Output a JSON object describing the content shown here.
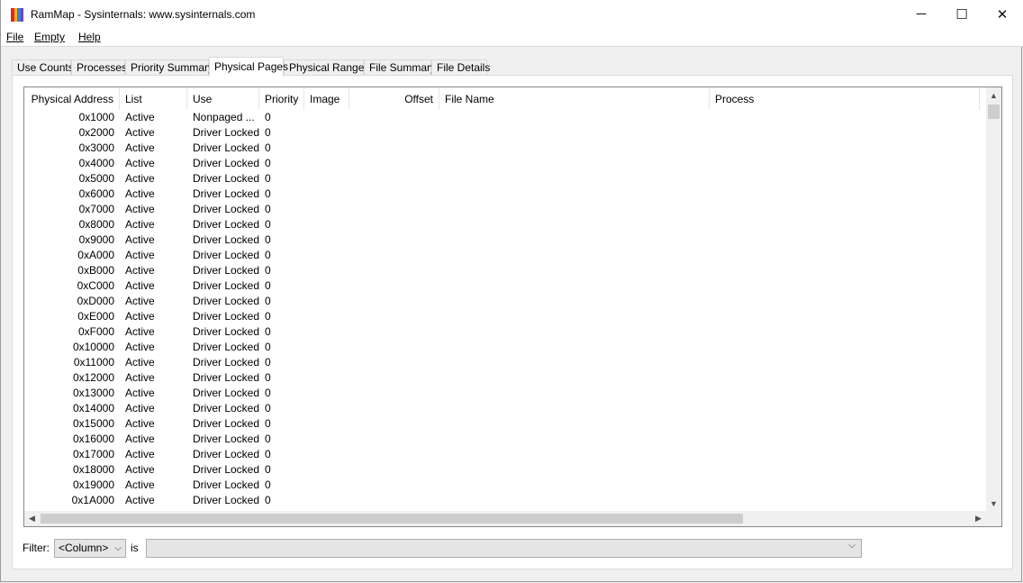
{
  "window": {
    "title": "RamMap - Sysinternals: www.sysinternals.com",
    "controls": {
      "minimize": "─",
      "maximize": "☐",
      "close": "✕"
    },
    "icon_colors": [
      "#e0262c",
      "#f6b20a",
      "#3a7ed8",
      "#7a3fb8"
    ]
  },
  "menu": [
    {
      "label": "File"
    },
    {
      "label": "Empty"
    },
    {
      "label": "Help"
    }
  ],
  "tabs": [
    {
      "label": "Use Counts",
      "active": false
    },
    {
      "label": "Processes",
      "active": false
    },
    {
      "label": "Priority Summary",
      "active": false
    },
    {
      "label": "Physical Pages",
      "active": true
    },
    {
      "label": "Physical Ranges",
      "active": false
    },
    {
      "label": "File Summary",
      "active": false
    },
    {
      "label": "File Details",
      "active": false
    }
  ],
  "table": {
    "columns": [
      "Physical Address",
      "List",
      "Use",
      "Priority",
      "Image",
      "Offset",
      "File Name",
      "Process"
    ],
    "rows": [
      [
        "0x1000",
        "Active",
        "Nonpaged ...",
        "0"
      ],
      [
        "0x2000",
        "Active",
        "Driver Locked",
        "0"
      ],
      [
        "0x3000",
        "Active",
        "Driver Locked",
        "0"
      ],
      [
        "0x4000",
        "Active",
        "Driver Locked",
        "0"
      ],
      [
        "0x5000",
        "Active",
        "Driver Locked",
        "0"
      ],
      [
        "0x6000",
        "Active",
        "Driver Locked",
        "0"
      ],
      [
        "0x7000",
        "Active",
        "Driver Locked",
        "0"
      ],
      [
        "0x8000",
        "Active",
        "Driver Locked",
        "0"
      ],
      [
        "0x9000",
        "Active",
        "Driver Locked",
        "0"
      ],
      [
        "0xA000",
        "Active",
        "Driver Locked",
        "0"
      ],
      [
        "0xB000",
        "Active",
        "Driver Locked",
        "0"
      ],
      [
        "0xC000",
        "Active",
        "Driver Locked",
        "0"
      ],
      [
        "0xD000",
        "Active",
        "Driver Locked",
        "0"
      ],
      [
        "0xE000",
        "Active",
        "Driver Locked",
        "0"
      ],
      [
        "0xF000",
        "Active",
        "Driver Locked",
        "0"
      ],
      [
        "0x10000",
        "Active",
        "Driver Locked",
        "0"
      ],
      [
        "0x11000",
        "Active",
        "Driver Locked",
        "0"
      ],
      [
        "0x12000",
        "Active",
        "Driver Locked",
        "0"
      ],
      [
        "0x13000",
        "Active",
        "Driver Locked",
        "0"
      ],
      [
        "0x14000",
        "Active",
        "Driver Locked",
        "0"
      ],
      [
        "0x15000",
        "Active",
        "Driver Locked",
        "0"
      ],
      [
        "0x16000",
        "Active",
        "Driver Locked",
        "0"
      ],
      [
        "0x17000",
        "Active",
        "Driver Locked",
        "0"
      ],
      [
        "0x18000",
        "Active",
        "Driver Locked",
        "0"
      ],
      [
        "0x19000",
        "Active",
        "Driver Locked",
        "0"
      ],
      [
        "0x1A000",
        "Active",
        "Driver Locked",
        "0"
      ]
    ]
  },
  "scroll_icons": {
    "up": "▲",
    "down": "▼",
    "left": "◀",
    "right": "▶"
  },
  "filter": {
    "label": "Filter:",
    "column_select": "<Column>",
    "is_label": "is",
    "value": "",
    "chevron": "⌵"
  }
}
